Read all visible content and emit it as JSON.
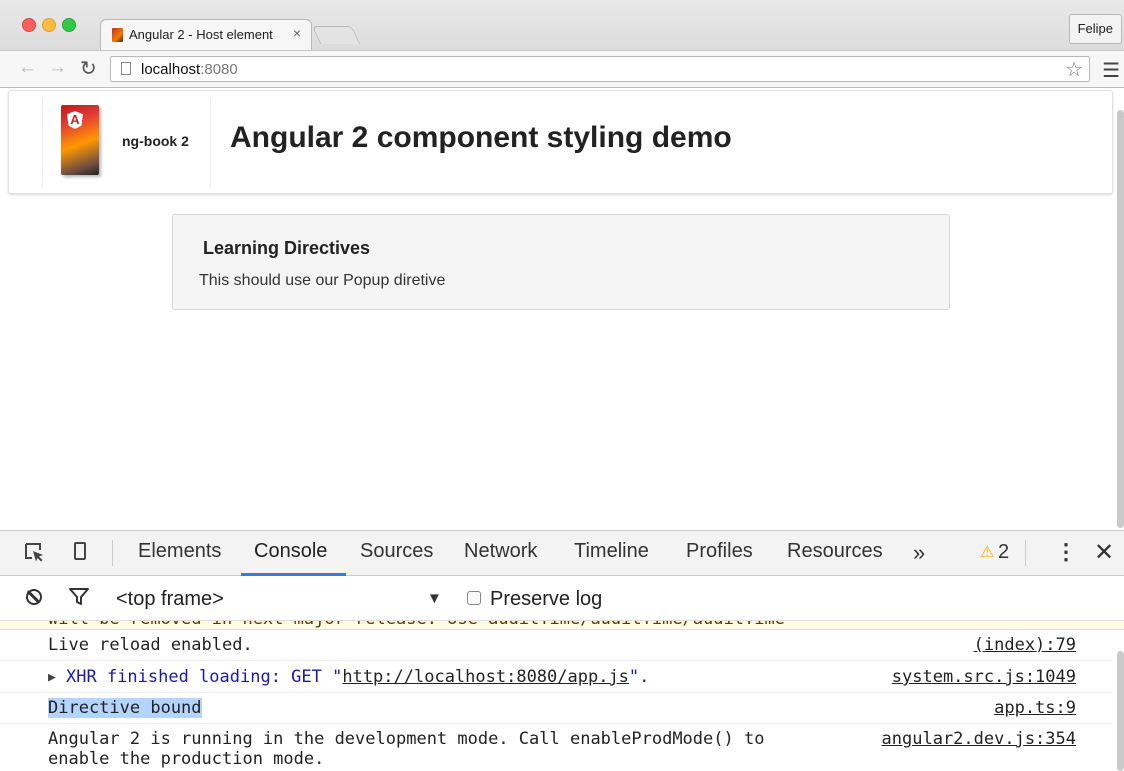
{
  "browser": {
    "tab_title": "Angular 2 - Host element",
    "tab_close": "×",
    "profile_name": "Felipe",
    "url_host": "localhost",
    "url_port": ":8080"
  },
  "icons": {
    "back": "back-arrow-icon",
    "forward": "forward-arrow-icon",
    "reload": "reload-icon",
    "star": "bookmark-star-icon",
    "menu": "hamburger-menu-icon"
  },
  "page": {
    "brand_name": "ng-book 2",
    "book_logo_letter": "A",
    "title": "Angular 2 component styling demo",
    "card": {
      "title": "Learning Directives",
      "text": "This should use our Popup diretive"
    }
  },
  "devtools": {
    "tabs": [
      "Elements",
      "Console",
      "Sources",
      "Network",
      "Timeline",
      "Profiles",
      "Resources"
    ],
    "active_tab": "Console",
    "more_label": "»",
    "warning_count": "2",
    "frame_select": "<top frame>",
    "preserve_log_label": "Preserve log",
    "preserve_log_checked": false,
    "console": {
      "cut_off_line": "will be removed in next major release. Use auditTime/auditTime/auditTime",
      "messages": [
        {
          "text": "Live reload enabled.",
          "source": "(index):79"
        },
        {
          "xhr_prefix": "XHR finished loading: GET \"",
          "xhr_url": "http://localhost:8080/app.js",
          "xhr_suffix": "\".",
          "source": "system.src.js:1049"
        },
        {
          "text": "Directive bound",
          "source": "app.ts:9"
        },
        {
          "text_line1": "Angular 2 is running in the development mode. Call enableProdMode() to",
          "text_line2": "enable the production mode.",
          "source": "angular2.dev.js:354"
        }
      ]
    }
  },
  "colors": {
    "active_tab_underline": "#3879d9",
    "warning": "#f4b400",
    "xhr_text": "#1a1aa6",
    "selection_highlight": "#b3d4fd"
  }
}
